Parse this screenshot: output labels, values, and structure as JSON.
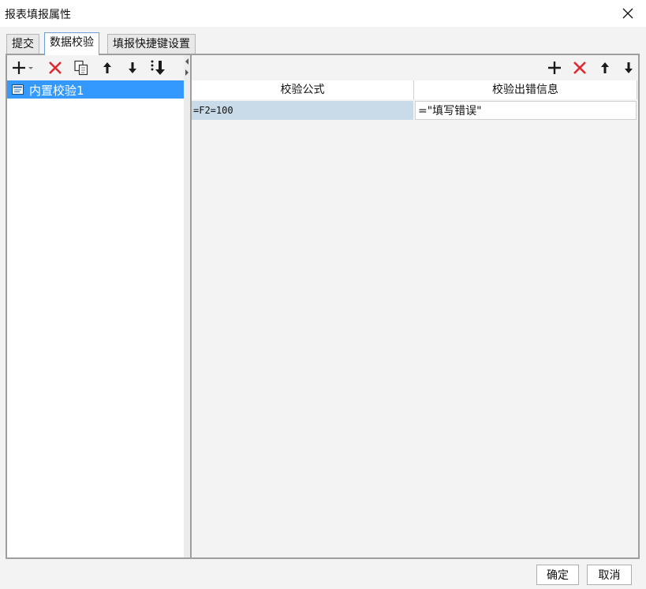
{
  "window": {
    "title": "报表填报属性",
    "close_icon": "close-icon"
  },
  "tabs": [
    {
      "label": "提交",
      "active": false
    },
    {
      "label": "数据校验",
      "active": true
    },
    {
      "label": "填报快捷键设置",
      "active": false
    }
  ],
  "left_toolbar": {
    "icons": [
      "add-dropdown-icon",
      "delete-icon",
      "copy-icon",
      "move-up-icon",
      "move-down-icon",
      "move-bottom-icon"
    ],
    "colors": {
      "delete": "#e0282e",
      "dark": "#1a1a1a"
    }
  },
  "left_list": {
    "items": [
      {
        "label": "内置校验1",
        "selected": true,
        "icon": "check-item-icon"
      }
    ],
    "selected_bg": "#3399ff"
  },
  "right_toolbar": {
    "icons": [
      "add-icon",
      "delete-icon",
      "move-up-icon",
      "move-down-icon"
    ]
  },
  "grid": {
    "columns": [
      "校验公式",
      "校验出错信息"
    ],
    "rows": [
      {
        "formula": "=F2=100",
        "message": "=\"填写错误\""
      }
    ]
  },
  "buttons": {
    "ok": "确定",
    "cancel": "取消"
  }
}
